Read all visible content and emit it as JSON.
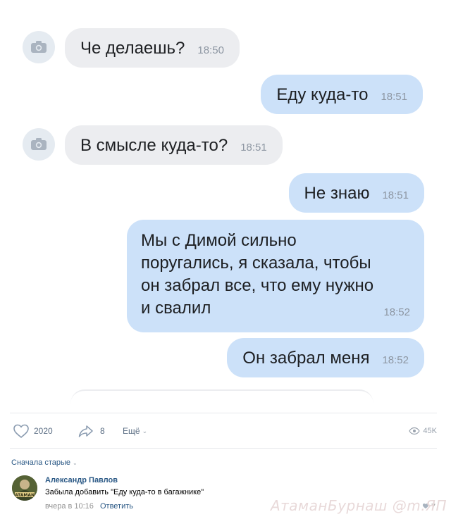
{
  "messages": [
    {
      "dir": "in",
      "text": "Че делаешь?",
      "time": "18:50"
    },
    {
      "dir": "out",
      "text": "Еду куда-то",
      "time": "18:51"
    },
    {
      "dir": "in",
      "text": "В смысле куда-то?",
      "time": "18:51"
    },
    {
      "dir": "out",
      "text": "Не знаю",
      "time": "18:51"
    },
    {
      "dir": "out",
      "text": "Мы с Димой сильно\nпоругались, я сказала, чтобы\nон забрал все, что ему нужно\nи свалил",
      "time": "18:52"
    },
    {
      "dir": "out",
      "text": "Он забрал меня",
      "time": "18:52"
    }
  ],
  "post_actions": {
    "likes": "2020",
    "shares": "8",
    "more_label": "Ещё",
    "views": "45K"
  },
  "comments": {
    "sort_label": "Сначала старые",
    "items": [
      {
        "author": "Александр Павлов",
        "text": "Забыла добавить \"Еду куда-то в багажнике\"",
        "date": "вчера в 10:16",
        "reply_label": "Ответить",
        "likes": "7"
      }
    ]
  },
  "watermark": "АтаманБурнаш @m.ЯП",
  "colors": {
    "incoming_bubble": "#ecedf0",
    "outgoing_bubble": "#cce1f9",
    "link": "#2a5885"
  },
  "icons": [
    "camera-icon",
    "heart-icon",
    "share-icon",
    "chevron-down-icon",
    "eye-icon"
  ]
}
